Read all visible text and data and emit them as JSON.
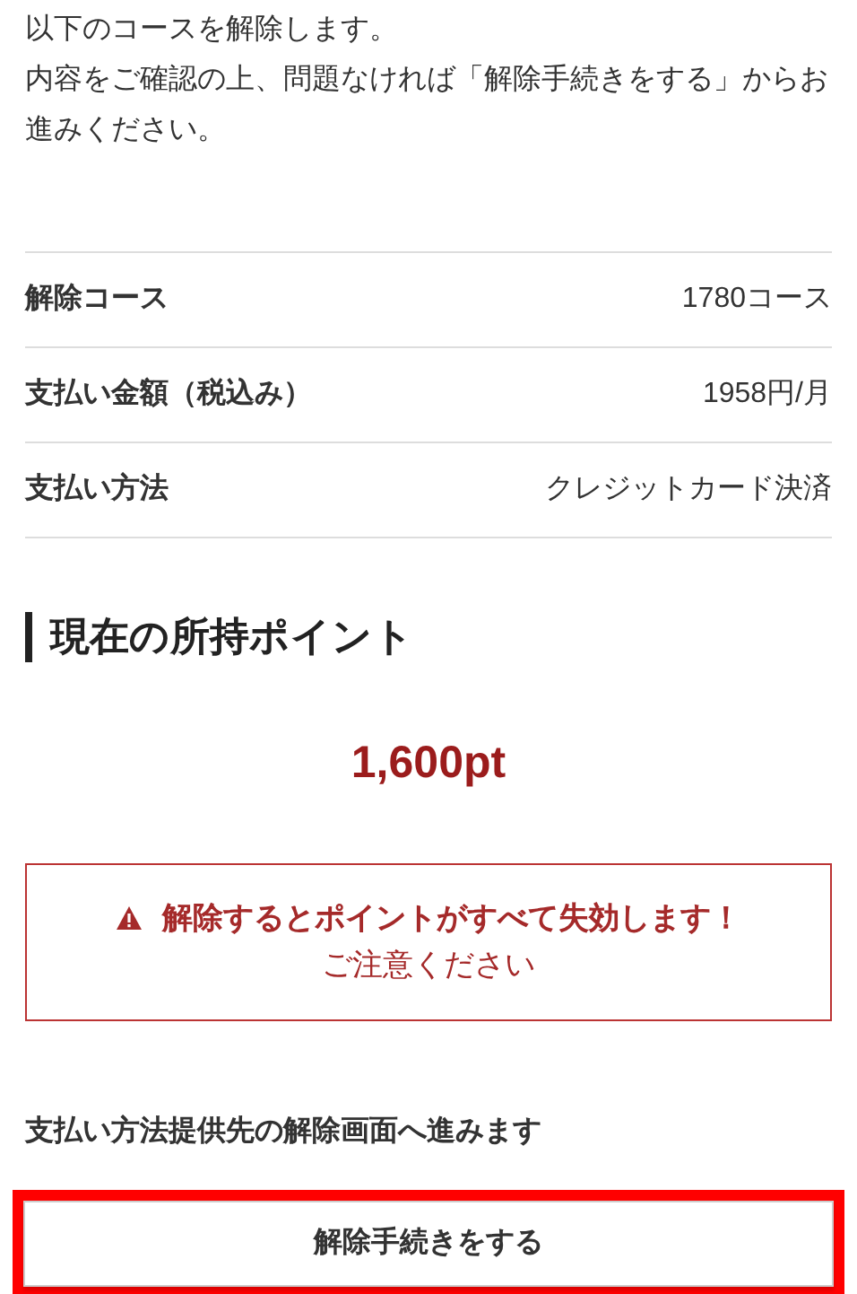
{
  "intro": [
    "以下のコースを解除します。",
    "内容をご確認の上、問題なければ「解除手続きをする」からお進みください。"
  ],
  "details": [
    {
      "label": "解除コース",
      "value": "1780コース"
    },
    {
      "label": "支払い金額（税込み）",
      "value": "1958円/月"
    },
    {
      "label": "支払い方法",
      "value": "クレジットカード決済"
    }
  ],
  "points": {
    "heading": "現在の所持ポイント",
    "amount": "1,600pt"
  },
  "warning": {
    "title": "解除するとポイントがすべて失効します！",
    "note": "ご注意ください"
  },
  "notice": "支払い方法提供先の解除画面へ進みます",
  "button": {
    "label": "解除手続きをする",
    "highlighted": true
  }
}
